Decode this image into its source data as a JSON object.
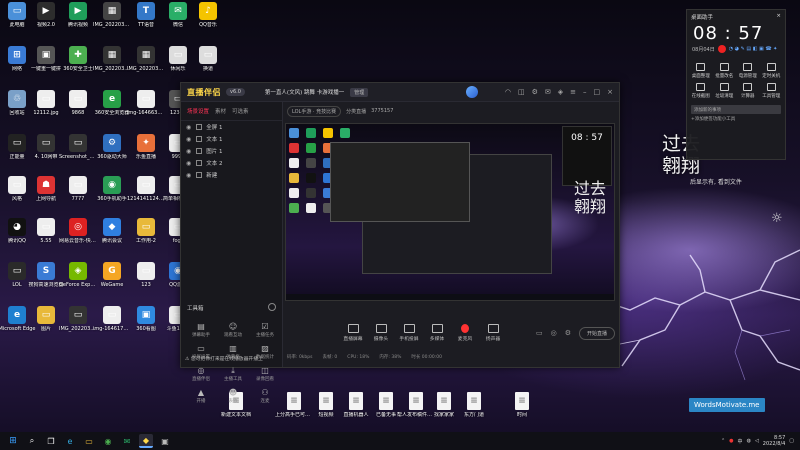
{
  "desktop": {
    "icons": [
      {
        "label": "此电脑",
        "color": "#4a90d9",
        "glyph": "▭"
      },
      {
        "label": "视频2.0",
        "color": "#2d2d2d",
        "glyph": "▶"
      },
      {
        "label": "腾讯视频",
        "color": "#1f9e5a",
        "glyph": "▶"
      },
      {
        "label": "IMG_20220307_184933",
        "color": "#444",
        "glyph": "▦"
      },
      {
        "label": "TT语音",
        "color": "#3478c8",
        "glyph": "T"
      },
      {
        "label": "微信",
        "color": "#2aae67",
        "glyph": "✉"
      },
      {
        "label": "QQ音乐",
        "color": "#f5c400",
        "glyph": "♪"
      },
      {
        "label": "网络",
        "color": "#3a7bd5",
        "glyph": "⊞"
      },
      {
        "label": "一键重一键拼",
        "color": "#555",
        "glyph": "▣"
      },
      {
        "label": "360安全卫士",
        "color": "#4caf50",
        "glyph": "✚"
      },
      {
        "label": "IMG_20220307_183758",
        "color": "#333",
        "glyph": "▦"
      },
      {
        "label": "IMG_20220307_183659",
        "color": "#333",
        "glyph": "▦"
      },
      {
        "label": "休闲乐",
        "color": "#ddd",
        "glyph": "▭"
      },
      {
        "label": "换道",
        "color": "#ddd",
        "glyph": "▭"
      },
      {
        "label": "回收站",
        "color": "#7aa0c8",
        "glyph": "♲"
      },
      {
        "label": "12112.jpg",
        "color": "#eee",
        "glyph": "▭"
      },
      {
        "label": "9868",
        "color": "#eee",
        "glyph": "▭"
      },
      {
        "label": "360安全浏览器",
        "color": "#27a047",
        "glyph": "e"
      },
      {
        "label": "img-1646637894586",
        "color": "#eee",
        "glyph": "▭"
      },
      {
        "label": "12345",
        "color": "#555",
        "glyph": "▭"
      },
      {
        "label": "IMG",
        "color": "#eee",
        "glyph": "▭"
      },
      {
        "label": "正能量",
        "color": "#222",
        "glyph": "▭"
      },
      {
        "label": "4. 10网带",
        "color": "#333",
        "glyph": "▭"
      },
      {
        "label": "Screenshot_20220307",
        "color": "#333",
        "glyph": "▭"
      },
      {
        "label": "360驱动大师",
        "color": "#2f6fbf",
        "glyph": "⚙"
      },
      {
        "label": "乐鱼直播",
        "color": "#e8703a",
        "glyph": "✦"
      },
      {
        "label": "9999",
        "color": "#eee",
        "glyph": "▭"
      },
      {
        "label": "看剧看4.12",
        "color": "#333",
        "glyph": "▭"
      },
      {
        "label": "风格",
        "color": "#eee",
        "glyph": "▭"
      },
      {
        "label": "上网导航",
        "color": "#d33",
        "glyph": "☗"
      },
      {
        "label": "7777",
        "color": "#eee",
        "glyph": "▭"
      },
      {
        "label": "360手机助手",
        "color": "#2a9d55",
        "glyph": "◉"
      },
      {
        "label": "1214141124124",
        "color": "#eee",
        "glyph": "▭"
      },
      {
        "label": "简单相框图片",
        "color": "#eee",
        "glyph": "▭"
      },
      {
        "label": "常用软件",
        "color": "#e8b93a",
        "glyph": "▭"
      },
      {
        "label": "腾讯QQ",
        "color": "#111",
        "glyph": "◕"
      },
      {
        "label": "5.55",
        "color": "#eee",
        "glyph": "▭"
      },
      {
        "label": "网易云音乐-快速启动",
        "color": "#d22",
        "glyph": "◎"
      },
      {
        "label": "腾讯会议",
        "color": "#2f7fe0",
        "glyph": "◆"
      },
      {
        "label": "工作用-2",
        "color": "#e8b93a",
        "glyph": "▭"
      },
      {
        "label": "fogs",
        "color": "#eee",
        "glyph": "▭"
      },
      {
        "label": "电影开片20220307",
        "color": "#333",
        "glyph": "▭"
      },
      {
        "label": "LOL",
        "color": "#2a2a2a",
        "glyph": "▭"
      },
      {
        "label": "搜狗高速浏览器",
        "color": "#3a7bd5",
        "glyph": "S"
      },
      {
        "label": "GeForce Experience",
        "color": "#76b900",
        "glyph": "◈"
      },
      {
        "label": "WeGame",
        "color": "#f5a623",
        "glyph": "G"
      },
      {
        "label": "123",
        "color": "#eee",
        "glyph": "▭"
      },
      {
        "label": "QQ游戏",
        "color": "#2d75d4",
        "glyph": "◉"
      },
      {
        "label": "img-1647738342864",
        "color": "#eee",
        "glyph": "▭"
      },
      {
        "label": "Microsoft Edge",
        "color": "#1f7fd0",
        "glyph": "e"
      },
      {
        "label": "图片",
        "color": "#e8b93a",
        "glyph": "▭"
      },
      {
        "label": "IMG_20220307_184816",
        "color": "#333",
        "glyph": "▭"
      },
      {
        "label": "img-1646178860384",
        "color": "#eee",
        "glyph": "▭"
      },
      {
        "label": "360看图",
        "color": "#2f8ae0",
        "glyph": "▣"
      },
      {
        "label": "斗鱼1234",
        "color": "#eee",
        "glyph": "▭"
      }
    ],
    "bottom_files": [
      {
        "label": "新建文本文档"
      },
      {
        "label": "上分高手已可选风景"
      },
      {
        "label": "短视频"
      },
      {
        "label": "直播机器人"
      },
      {
        "label": "已备无事"
      },
      {
        "label": "帮人发布稿件大全"
      },
      {
        "label": "找家家家"
      },
      {
        "label": "东方门道"
      },
      {
        "label": "时间"
      }
    ],
    "big_text": "过去\n翱翔",
    "sub_text": "后显示有, 看到文件",
    "watermark": "WordsMotivate.me"
  },
  "app": {
    "logo": "直播伴侣",
    "version": "v6.0",
    "room_title": "第一直人(文风) 跳舞 卡游戏播一",
    "room_btn": "管理",
    "scene_tabs": [
      "场景设置",
      "素材",
      "可选素"
    ],
    "sources": [
      {
        "label": "全屏 1"
      },
      {
        "label": "文本 1"
      },
      {
        "label": "图片 1"
      },
      {
        "label": "文本 2"
      },
      {
        "label": "新建"
      }
    ],
    "subtabs": [
      "LOL手游 · 竞技比赛",
      "分类直播",
      "3775157"
    ],
    "tools_title": "工具箱",
    "tools": [
      {
        "label": "弹幕助手",
        "glyph": "▤"
      },
      {
        "label": "观看互动",
        "glyph": "☺"
      },
      {
        "label": "主播任务",
        "glyph": "☑"
      },
      {
        "label": "投屏设置",
        "glyph": "▭"
      },
      {
        "label": "弹幕框",
        "glyph": "▥"
      },
      {
        "label": "数据统计",
        "glyph": "▨"
      },
      {
        "label": "直播伴侣",
        "glyph": "◎"
      },
      {
        "label": "主播工具",
        "glyph": "⤓"
      },
      {
        "label": "录像回看",
        "glyph": "◫"
      },
      {
        "label": "开播",
        "glyph": "▲"
      },
      {
        "label": "表情",
        "glyph": "☻"
      },
      {
        "label": "连麦",
        "glyph": "⚇"
      }
    ],
    "hint": "您可把你打来是在线播放器开播上",
    "controls": [
      {
        "label": "直播屏幕"
      },
      {
        "label": "摄像头"
      },
      {
        "label": "手机投屏"
      },
      {
        "label": "多媒体"
      },
      {
        "label": "麦克风"
      },
      {
        "label": "扬声器"
      }
    ],
    "start_label": "开始直播",
    "status": [
      "码率: 0kbps",
      "丢帧: 0",
      "CPU: 18%",
      "内存: 38%",
      "时长 00:00:00"
    ]
  },
  "widget": {
    "title": "桌面助手",
    "time": "08 : 57",
    "date": "08月04日",
    "cells": [
      {
        "label": "桌面整理"
      },
      {
        "label": "批量改名"
      },
      {
        "label": "电源管理"
      },
      {
        "label": "定时关机"
      },
      {
        "label": "在线截图"
      },
      {
        "label": "垃圾清理"
      },
      {
        "label": "计算器"
      },
      {
        "label": "工具管理"
      }
    ],
    "input_placeholder": "添加新的事项",
    "links": "+添加便签功能小工具"
  },
  "taskbar": {
    "time": "8:57",
    "date": "2022/8/4",
    "lang": "中"
  }
}
